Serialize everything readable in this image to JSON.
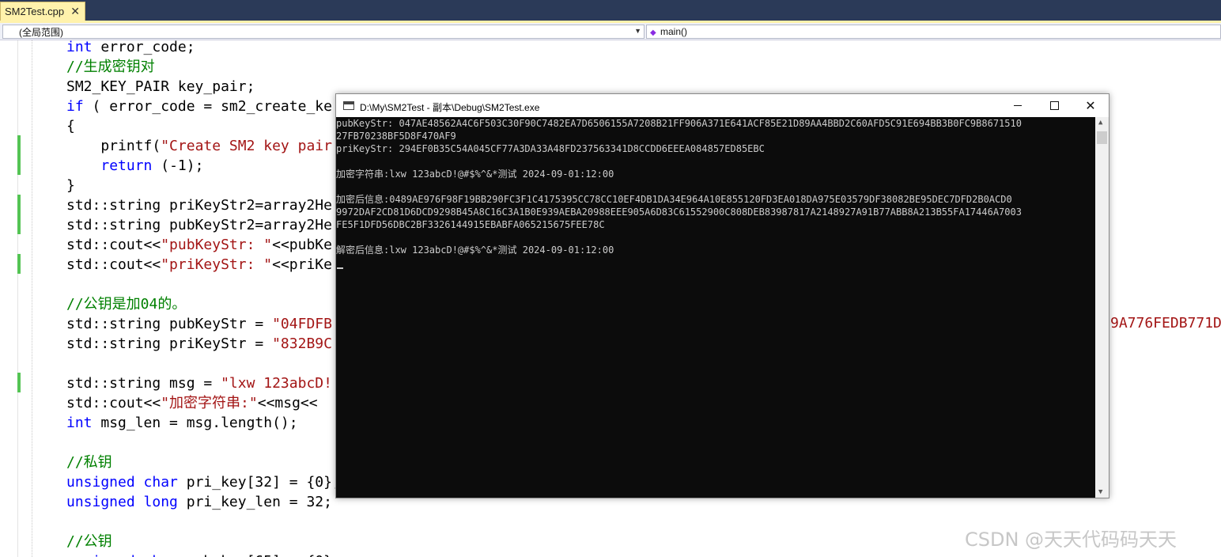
{
  "tab": {
    "title": "SM2Test.cpp",
    "close_glyph": "✕"
  },
  "nav": {
    "scope": "(全局范围)",
    "member": "main()"
  },
  "editor": {
    "lines": [
      [
        {
          "c": "kw",
          "t": "int"
        },
        {
          "c": "",
          "t": " error_code;"
        }
      ],
      [
        {
          "c": "cmt",
          "t": "//生成密钥对"
        }
      ],
      [
        {
          "c": "",
          "t": "SM2_KEY_PAIR key_pair;"
        }
      ],
      [
        {
          "c": "kw",
          "t": "if"
        },
        {
          "c": "",
          "t": " ( error_code = sm2_create_ke"
        }
      ],
      [
        {
          "c": "",
          "t": "{"
        }
      ],
      [
        {
          "c": "",
          "t": "    printf("
        },
        {
          "c": "str",
          "t": "\"Create SM2 key pair"
        }
      ],
      [
        {
          "c": "",
          "t": "    "
        },
        {
          "c": "kw",
          "t": "return"
        },
        {
          "c": "",
          "t": " (-1);"
        }
      ],
      [
        {
          "c": "",
          "t": "}"
        }
      ],
      [
        {
          "c": "",
          "t": "std::string priKeyStr2=array2He"
        }
      ],
      [
        {
          "c": "",
          "t": "std::string pubKeyStr2=array2He"
        }
      ],
      [
        {
          "c": "",
          "t": "std::cout<<"
        },
        {
          "c": "str",
          "t": "\"pubKeyStr: \""
        },
        {
          "c": "",
          "t": "<<pubKe"
        }
      ],
      [
        {
          "c": "",
          "t": "std::cout<<"
        },
        {
          "c": "str",
          "t": "\"priKeyStr: \""
        },
        {
          "c": "",
          "t": "<<priKe"
        }
      ],
      [],
      [
        {
          "c": "cmt",
          "t": "//公钥是加04的。"
        }
      ],
      [
        {
          "c": "",
          "t": "std::string pubKeyStr = "
        },
        {
          "c": "str",
          "t": "\"04FDFB"
        }
      ],
      [
        {
          "c": "",
          "t": "std::string priKeyStr = "
        },
        {
          "c": "str",
          "t": "\"832B9C"
        }
      ],
      [],
      [
        {
          "c": "",
          "t": "std::string msg = "
        },
        {
          "c": "str",
          "t": "\"lxw 123abcD!"
        }
      ],
      [
        {
          "c": "",
          "t": "std::cout<<"
        },
        {
          "c": "str",
          "t": "\"加密字符串:\""
        },
        {
          "c": "",
          "t": "<<msg<<"
        }
      ],
      [
        {
          "c": "kw",
          "t": "int"
        },
        {
          "c": "",
          "t": " msg_len = msg.length();"
        }
      ],
      [],
      [
        {
          "c": "cmt",
          "t": "//私钥"
        }
      ],
      [
        {
          "c": "kw",
          "t": "unsigned char"
        },
        {
          "c": "",
          "t": " pri_key[32] = {0};"
        }
      ],
      [
        {
          "c": "kw",
          "t": "unsigned long"
        },
        {
          "c": "",
          "t": " pri_key_len = 32;"
        }
      ],
      [],
      [
        {
          "c": "cmt",
          "t": "//公钥"
        }
      ],
      [
        {
          "c": "kw",
          "t": "unsigned char"
        },
        {
          "c": "",
          "t": " pub_key[65] = {0};"
        }
      ]
    ],
    "overflow_fragment": "9A776FEDB771D"
  },
  "console": {
    "title": "D:\\My\\SM2Test - 副本\\Debug\\SM2Test.exe",
    "minimize": "",
    "maximize": "",
    "close": "✕",
    "lines": [
      "pubKeyStr: 047AE48562A4C6F503C30F90C7482EA7D6506155A7208B21FF906A371E641ACF85E21D89AA4BBD2C60AFD5C91E694BB3B0FC9B8671510",
      "27FB70238BF5D8F470AF9",
      "priKeyStr: 294EF0B35C54A045CF77A3DA33A48FD237563341D8CCDD6EEEA084857ED85EBC",
      "",
      "加密字符串:lxw 123abcD!@#$%^&*测试 2024-09-01:12:00",
      "",
      "加密后信息:0489AE976F98F19BB290FC3F1C4175395CC78CC10EF4DB1DA34E964A10E855120FD3EA018DA975E03579DF38082BE95DEC7DFD2B0ACD0",
      "9972DAF2CD81D6DCD9298B45A8C16C3A1B0E939AEBA20988EEE905A6D83C61552900C808DEB83987817A2148927A91B77ABB8A213B55FA17446A7003",
      "FE5F1DFD56DBC2BF3326144915EBABFA065215675FEE78C",
      "",
      "解密后信息:lxw 123abcD!@#$%^&*测试 2024-09-01:12:00"
    ]
  },
  "watermark": "CSDN @天天代码码天天"
}
